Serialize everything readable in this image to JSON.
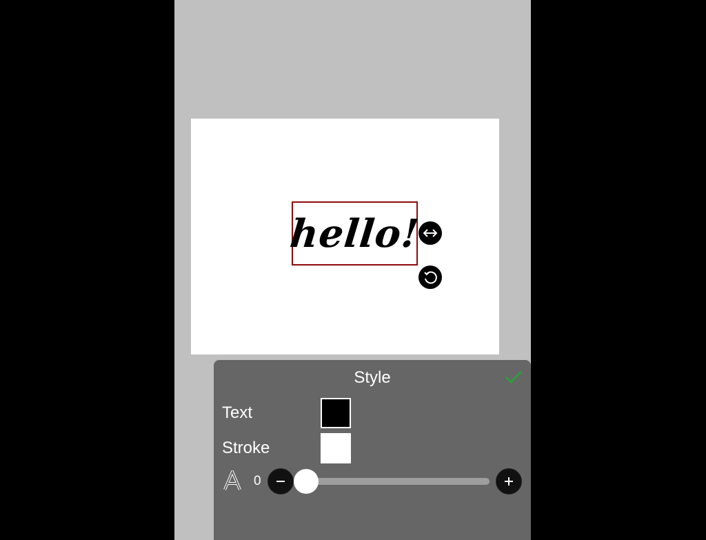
{
  "editor": {
    "canvas_text": "hello!"
  },
  "style_panel": {
    "title": "Style",
    "text_label": "Text",
    "stroke_label": "Stroke",
    "text_color": "#000000",
    "stroke_color": "#ffffff",
    "stroke_width_value": "0",
    "stroke_width_slider_level": 0,
    "accent_color": "#2e9e3e"
  },
  "icons": {
    "resize": "resize-horizontal-icon",
    "rotate": "rotate-icon",
    "confirm": "checkmark-icon",
    "stroke_font": "outline-letter-a-icon",
    "decrease": "minus-icon",
    "increase": "plus-icon"
  }
}
